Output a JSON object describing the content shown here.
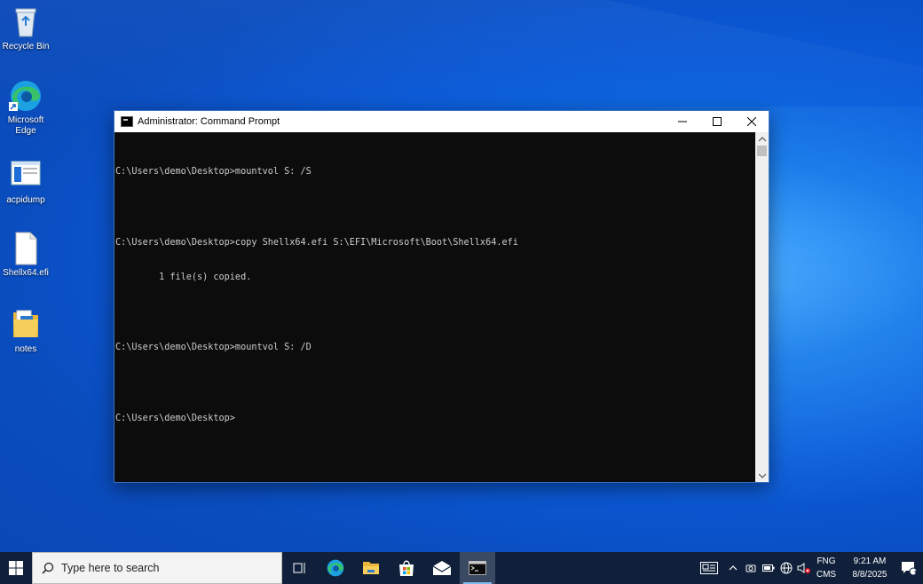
{
  "desktop": {
    "icons": [
      {
        "label": "Recycle Bin"
      },
      {
        "label": "Microsoft Edge"
      },
      {
        "label": "acpidump"
      },
      {
        "label": "Shellx64.efi"
      },
      {
        "label": "notes"
      }
    ]
  },
  "window": {
    "title": "Administrator: Command Prompt",
    "console_lines": [
      "C:\\Users\\demo\\Desktop>mountvol S: /S",
      "",
      "C:\\Users\\demo\\Desktop>copy Shellx64.efi S:\\EFI\\Microsoft\\Boot\\Shellx64.efi",
      "        1 file(s) copied.",
      "",
      "C:\\Users\\demo\\Desktop>mountvol S: /D",
      "",
      "C:\\Users\\demo\\Desktop>"
    ]
  },
  "taskbar": {
    "search_placeholder": "Type here to search",
    "tray": {
      "lang_line1": "FNG",
      "lang_line2": "CMS",
      "time": "9:21 AM",
      "date": "8/8/2025",
      "notification_count": "1"
    }
  }
}
